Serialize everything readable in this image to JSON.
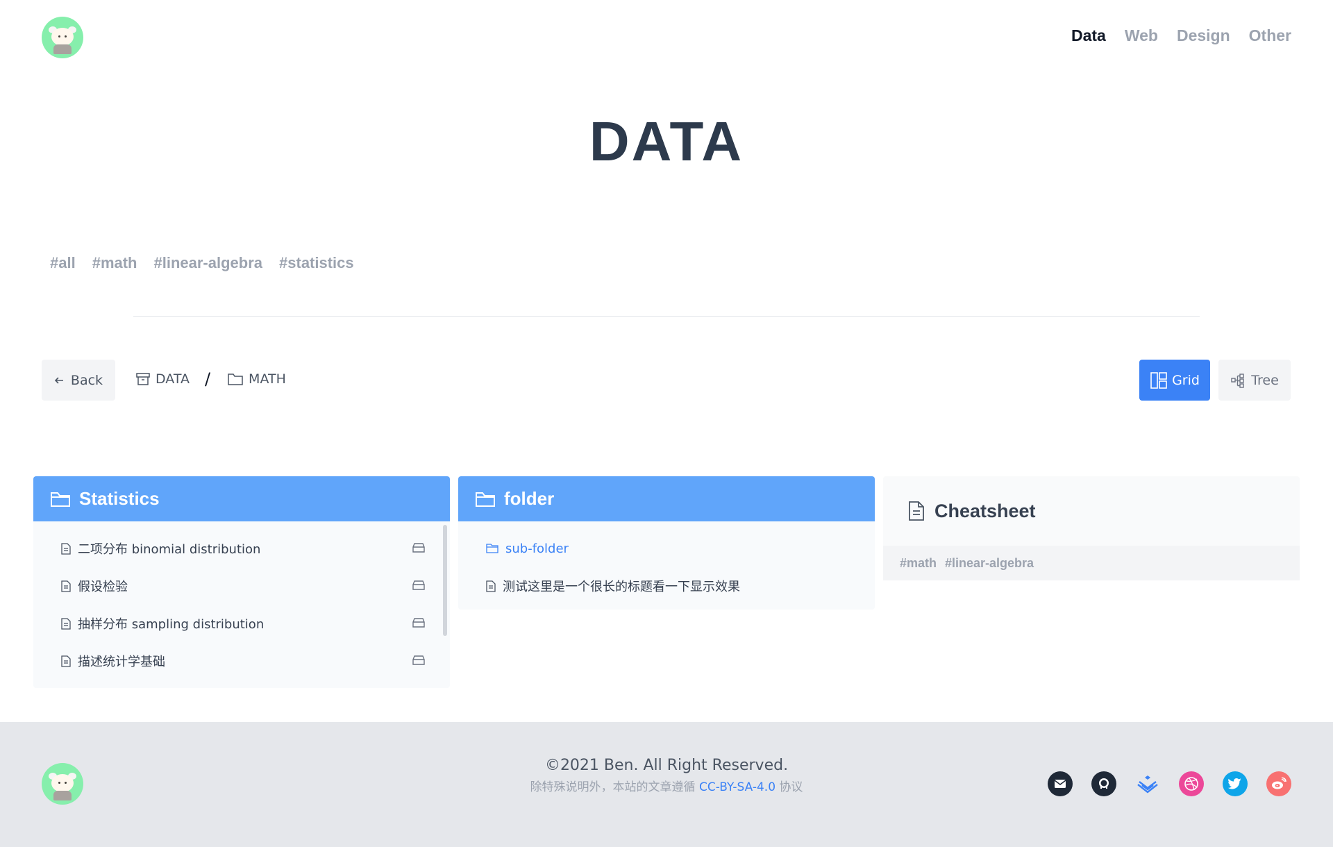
{
  "header": {
    "nav": [
      {
        "label": "Data",
        "active": true
      },
      {
        "label": "Web",
        "active": false
      },
      {
        "label": "Design",
        "active": false
      },
      {
        "label": "Other",
        "active": false
      }
    ]
  },
  "page": {
    "title": "DATA",
    "tags": [
      "#all",
      "#math",
      "#linear-algebra",
      "#statistics"
    ]
  },
  "toolbar": {
    "back_label": "Back",
    "breadcrumb": [
      "DATA",
      "MATH"
    ],
    "breadcrumb_sep": "/",
    "view_grid_label": "Grid",
    "view_tree_label": "Tree",
    "active_view": "Grid"
  },
  "cards": {
    "statistics": {
      "title": "Statistics",
      "items": [
        "二项分布 binomial distribution",
        "假设检验",
        "抽样分布 sampling distribution",
        "描述统计学基础"
      ]
    },
    "folder": {
      "title": "folder",
      "subfolder": "sub-folder",
      "items": [
        "测试这里是一个很长的标题看一下显示效果"
      ]
    },
    "cheatsheet": {
      "title": "Cheatsheet",
      "tags": [
        "#math",
        "#linear-algebra"
      ]
    }
  },
  "footer": {
    "copyright": "©2021 Ben. All Right Reserved.",
    "license_prefix": "除特殊说明外，本站的文章遵循",
    "license_link": "CC-BY-SA-4.0",
    "license_suffix": "协议",
    "socials": [
      "mail-icon",
      "github-icon",
      "juejin-icon",
      "dribbble-icon",
      "twitter-icon",
      "weibo-icon"
    ]
  },
  "colors": {
    "accent": "#3b82f6",
    "card_header": "#60a5fa",
    "footer_bg": "#e5e7eb",
    "title": "#2d3a4c"
  }
}
